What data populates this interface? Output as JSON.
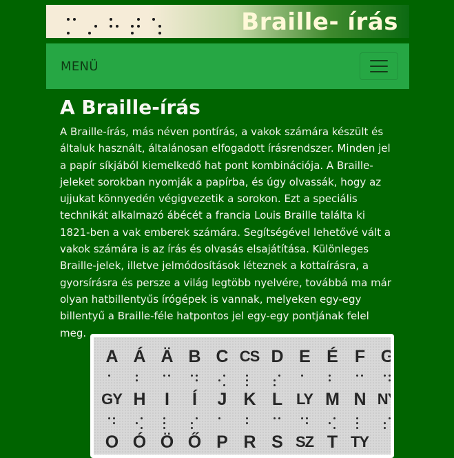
{
  "banner": {
    "title": "Braille- írás",
    "dot_cells": [
      [
        1,
        0,
        1,
        1,
        0,
        0
      ],
      [
        0,
        0,
        1,
        0,
        1,
        0
      ],
      [
        1,
        1,
        0,
        0,
        1,
        0
      ],
      [
        0,
        1,
        1,
        1,
        1,
        0
      ],
      [
        1,
        0,
        0,
        0,
        1,
        1
      ]
    ]
  },
  "nav": {
    "menu_label": "MENÜ"
  },
  "main": {
    "heading": "A Braille-írás",
    "paragraph": "A Braille-írás, más néven pontírás, a vakok számára készült és általuk használt, általánosan elfogadott írásrendszer. Minden jel a papír síkjából kiemelkedő hat pont kombinációja. A Braille-jeleket sorokban nyomják a papírba, és úgy olvassák, hogy az ujjukat könnyedén végigvezetik a sorokon. Ezt a speciális technikát alkalmazó ábécét a francia Louis Braille találta ki 1821-ben a vak emberek számára. Segítségével lehetővé vált a vakok számára is az írás és olvasás elsajátítása. Különleges Braille-jelek, illetve jelmódosítások léteznek a kottaírásra, a gyorsírásra és persze a világ legtöbb nyelvére, továbbá ma már olyan hatbillentyűs írógépek is vannak, melyeken egy-egy billentyű a Braille-féle hatpontos jel egy-egy pontjának felel meg."
  },
  "figure": {
    "rows": [
      [
        "A",
        "Á",
        "Ä",
        "B",
        "C",
        "CS",
        "D",
        "E",
        "É",
        "F",
        "G"
      ],
      [
        "GY",
        "H",
        "I",
        "Í",
        "J",
        "K",
        "L",
        "LY",
        "M",
        "N",
        "NY"
      ],
      [
        "O",
        "Ó",
        "Ö",
        "Ő",
        "P",
        "R",
        "S",
        "SZ",
        "T",
        "TY"
      ]
    ]
  }
}
